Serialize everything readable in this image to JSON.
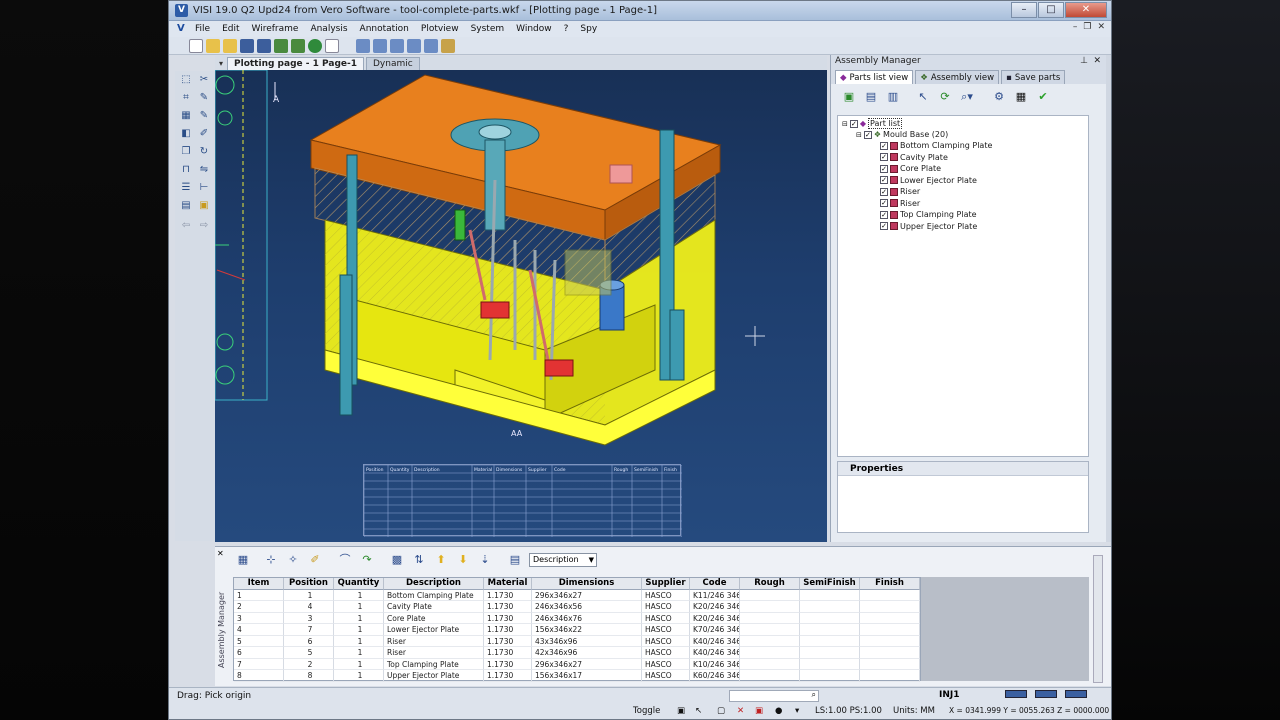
{
  "window": {
    "title": "VISI 19.0 Q2 Upd24 from Vero Software - tool-complete-parts.wkf - [Plotting page - 1 Page-1]",
    "app_icon_letter": "V"
  },
  "menu": [
    "File",
    "Edit",
    "Wireframe",
    "Analysis",
    "Annotation",
    "Plotview",
    "System",
    "Window",
    "?",
    "Spy"
  ],
  "doc_tabs": [
    {
      "label": "Plotting page - 1 Page-1",
      "active": true
    },
    {
      "label": "Dynamic",
      "active": false
    }
  ],
  "viewport": {
    "axis_label": "A",
    "bottom_mark": "AA",
    "table_headers": [
      "Position",
      "Quantity",
      "Description",
      "Material",
      "Dimensions",
      "Supplier",
      "Code",
      "Rough",
      "SemiFinish",
      "Finish"
    ]
  },
  "assembly_manager": {
    "title": "Assembly Manager",
    "tabs": [
      "Parts list view",
      "Assembly view",
      "Save parts"
    ],
    "tree_root": "Part list",
    "mould_base": "Mould Base (20)",
    "parts": [
      "Bottom Clamping Plate",
      "Cavity Plate",
      "Core Plate",
      "Lower Ejector Plate",
      "Riser",
      "Riser",
      "Top Clamping Plate",
      "Upper Ejector Plate"
    ],
    "properties_title": "Properties"
  },
  "bottom_panel": {
    "side_label": "Assembly Manager",
    "dropdown_value": "Description",
    "columns": [
      "Item",
      "Position",
      "Quantity",
      "Description",
      "Material",
      "Dimensions",
      "Supplier",
      "Code",
      "Rough",
      "SemiFinish",
      "Finish"
    ],
    "rows": [
      [
        "1",
        "1",
        "1",
        "Bottom Clamping Plate",
        "1.1730",
        "296x346x27",
        "HASCO",
        "K11/246 346",
        "",
        "",
        ""
      ],
      [
        "2",
        "4",
        "1",
        "Cavity Plate",
        "1.1730",
        "246x346x56",
        "HASCO",
        "K20/246 346",
        "",
        "",
        ""
      ],
      [
        "3",
        "3",
        "1",
        "Core Plate",
        "1.1730",
        "246x346x76",
        "HASCO",
        "K20/246 346",
        "",
        "",
        ""
      ],
      [
        "4",
        "7",
        "1",
        "Lower Ejector Plate",
        "1.1730",
        "156x346x22",
        "HASCO",
        "K70/246 346",
        "",
        "",
        ""
      ],
      [
        "5",
        "6",
        "1",
        "Riser",
        "1.1730",
        "43x346x96",
        "HASCO",
        "K40/246 346",
        "",
        "",
        ""
      ],
      [
        "6",
        "5",
        "1",
        "Riser",
        "1.1730",
        "42x346x96",
        "HASCO",
        "K40/246 346",
        "",
        "",
        ""
      ],
      [
        "7",
        "2",
        "1",
        "Top Clamping Plate",
        "1.1730",
        "296x346x27",
        "HASCO",
        "K10/246 346",
        "",
        "",
        ""
      ],
      [
        "8",
        "8",
        "1",
        "Upper Ejector Plate",
        "1.1730",
        "156x346x17",
        "HASCO",
        "K60/246 346",
        "",
        "",
        ""
      ]
    ]
  },
  "status": {
    "message": "Drag: Pick origin",
    "mode": "INJ1",
    "toggle": "Toggle",
    "scale": "LS:1.00 PS:1.00",
    "units": "Units: MM",
    "coords": "X = 0341.999 Y = 0055.263 Z = 0000.000"
  }
}
